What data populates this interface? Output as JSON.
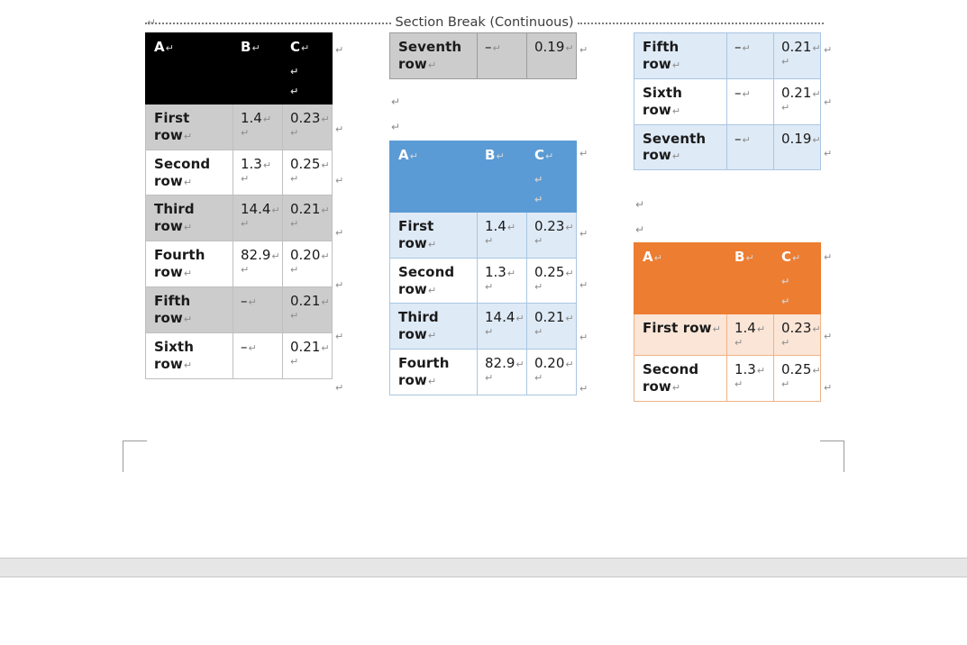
{
  "document": {
    "section_break_label": "Section Break (Continuous)",
    "paragraph_mark": "↵",
    "space_dot": "·",
    "dash": "–"
  },
  "columns": {
    "headers": [
      "A",
      "B",
      "C"
    ]
  },
  "tables": [
    {
      "id": "table-black",
      "name": "black-header-table",
      "header_style": "black",
      "header": [
        "A",
        "B",
        "C"
      ],
      "rows": [
        {
          "label": "First row",
          "b": "1.4",
          "c": "0.23",
          "band": true
        },
        {
          "label": "Second row",
          "b": "1.3",
          "c": "0.25",
          "band": false
        },
        {
          "label": "Third row",
          "b": "14.4",
          "c": "0.21",
          "band": true
        },
        {
          "label": "Fourth row",
          "b": "82.9",
          "c": "0.20",
          "band": false
        },
        {
          "label": "Fifth row",
          "b": "–",
          "c": "0.21",
          "band": true
        },
        {
          "label": "Sixth row",
          "b": "–",
          "c": "0.21",
          "band": false
        }
      ]
    },
    {
      "id": "table-gray-row",
      "name": "gray-continuation-table",
      "header_style": "none",
      "rows": [
        {
          "label": "Seventh row",
          "b": "–",
          "c": "0.19",
          "band": true
        }
      ]
    },
    {
      "id": "table-blue",
      "name": "blue-header-table",
      "header_style": "blue",
      "header": [
        "A",
        "B",
        "C"
      ],
      "rows": [
        {
          "label": "First row",
          "b": "1.4",
          "c": "0.23",
          "band": true
        },
        {
          "label": "Second row",
          "b": "1.3",
          "c": "0.25",
          "band": false
        },
        {
          "label": "Third row",
          "b": "14.4",
          "c": "0.21",
          "band": true
        },
        {
          "label": "Fourth row",
          "b": "82.9",
          "c": "0.20",
          "band": false
        }
      ]
    },
    {
      "id": "table-blue-rows",
      "name": "blue-continuation-table",
      "header_style": "none",
      "rows": [
        {
          "label": "Fifth row",
          "b": "–",
          "c": "0.21",
          "band": true
        },
        {
          "label": "Sixth row",
          "b": "–",
          "c": "0.21",
          "band": false
        },
        {
          "label": "Seventh row",
          "b": "–",
          "c": "0.19",
          "band": true
        }
      ]
    },
    {
      "id": "table-orange",
      "name": "orange-header-table",
      "header_style": "orange",
      "header": [
        "A",
        "B",
        "C"
      ],
      "rows": [
        {
          "label": "First row",
          "b": "1.4",
          "c": "0.23",
          "band": true
        },
        {
          "label": "Second row",
          "b": "1.3",
          "c": "0.25",
          "band": false
        }
      ]
    }
  ],
  "colors": {
    "header_black": "#000000",
    "header_blue": "#5B9BD5",
    "band_blue": "#DEEAF6",
    "header_orange": "#ED7D31",
    "band_orange": "#FBE5D6",
    "band_gray": "#CCCCCC",
    "text": "#1A1A1A",
    "mark": "#8C8C8C"
  }
}
